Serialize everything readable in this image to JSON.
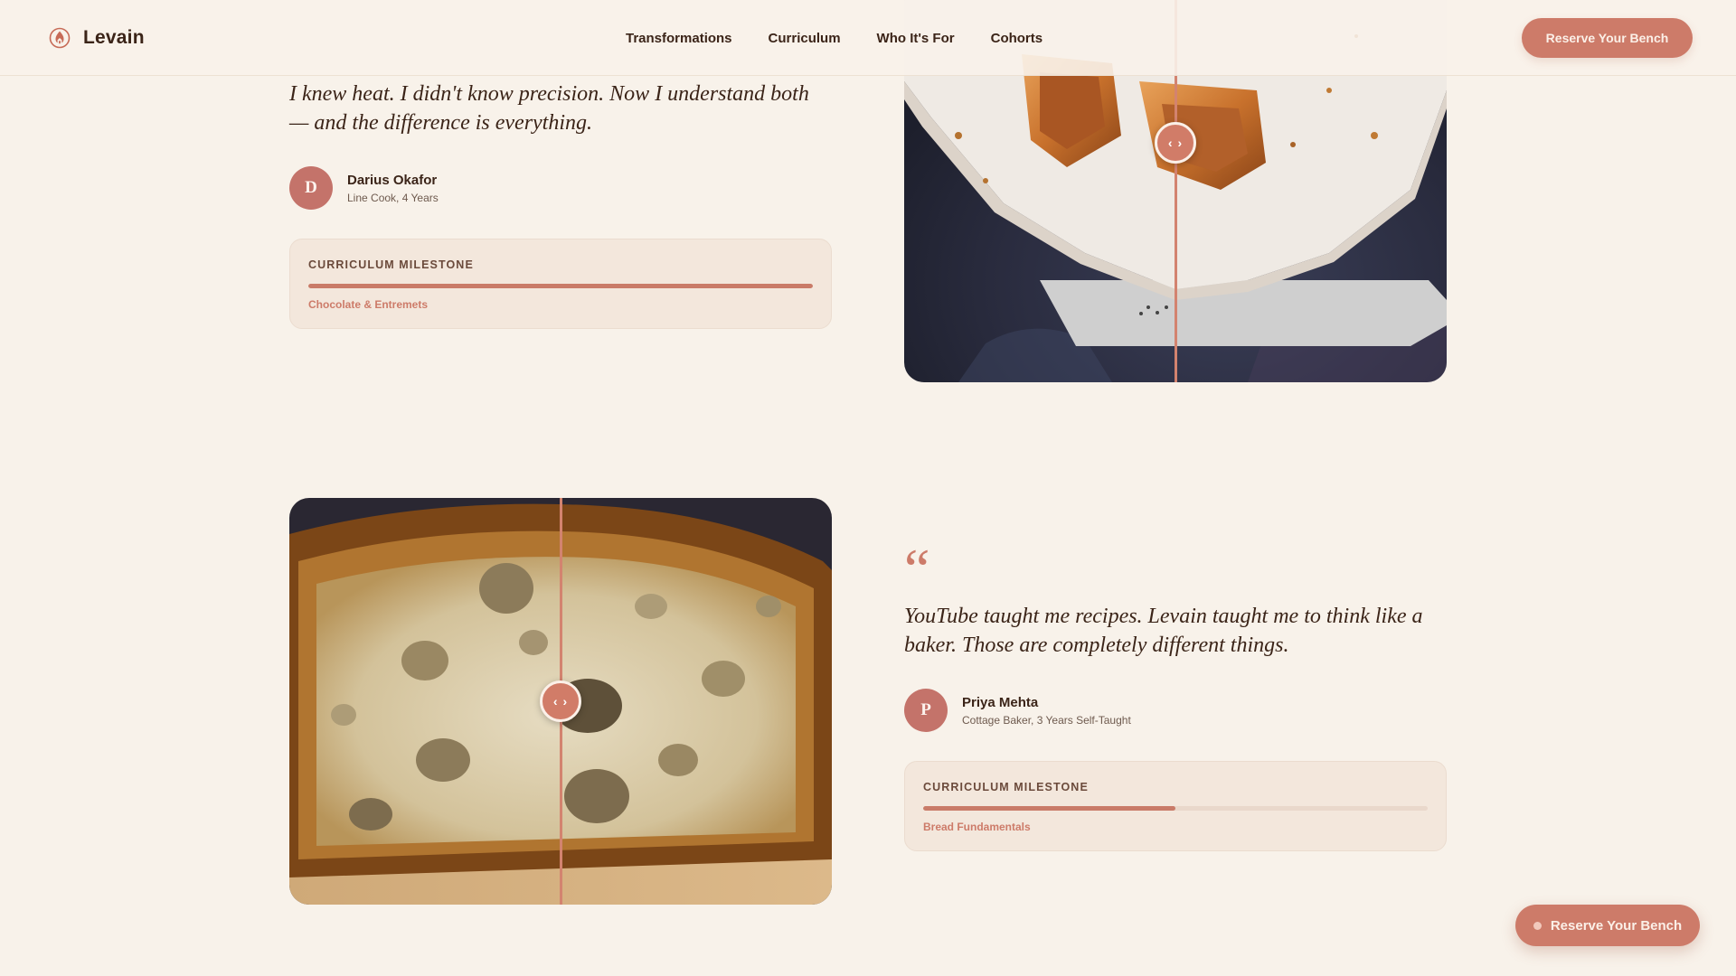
{
  "header": {
    "brand": "Levain",
    "nav": [
      "Transformations",
      "Curriculum",
      "Who It's For",
      "Cohorts"
    ],
    "cta": "Reserve Your Bench"
  },
  "testimonials": [
    {
      "quote": "I knew heat. I didn't know precision. Now I understand both — and the difference is everything.",
      "initial": "D",
      "name": "Darius Okafor",
      "role": "Line Cook, 4 Years",
      "milestone_label": "CURRICULUM MILESTONE",
      "milestone": "Chocolate & Entremets",
      "progress": 1.0,
      "image": "tart-shells-on-parchment"
    },
    {
      "quote_mark": "“",
      "quote": "YouTube taught me recipes. Levain taught me to think like a baker. Those are completely different things.",
      "initial": "P",
      "name": "Priya Mehta",
      "role": "Cottage Baker, 3 Years Self-Taught",
      "milestone_label": "CURRICULUM MILESTONE",
      "milestone": "Bread Fundamentals",
      "progress": 0.5,
      "image": "sourdough-loaf-crumb"
    }
  ],
  "compare_handle_glyph": "‹ ›",
  "floating_cta": "Reserve Your Bench",
  "icons": {
    "brand": "flame-house-icon",
    "handle": "drag-handle-icon"
  },
  "colors": {
    "background": "#f8f2ea",
    "accent": "#cd7b69",
    "text": "#3b2418"
  }
}
